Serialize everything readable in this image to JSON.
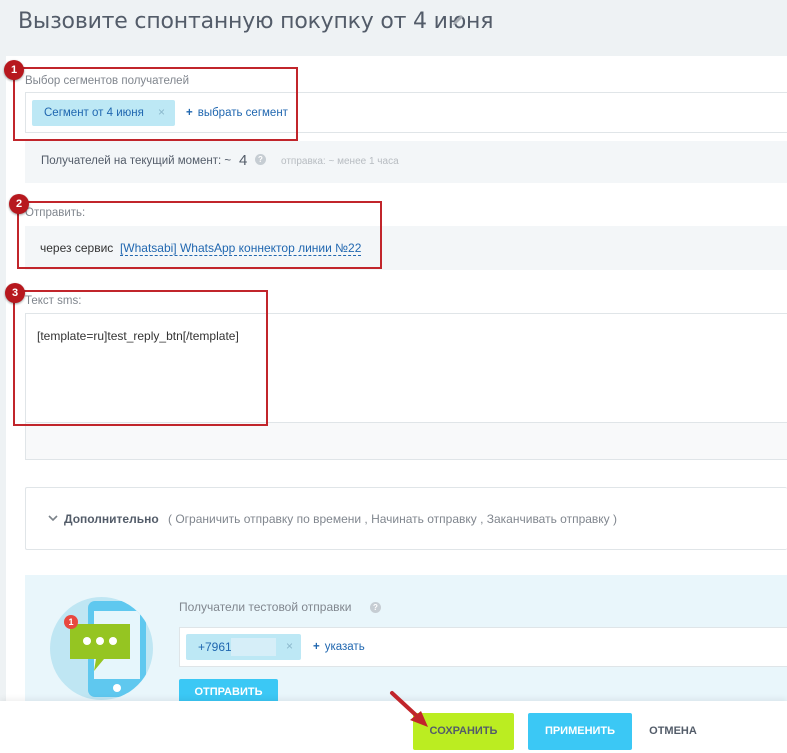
{
  "page": {
    "title": "Вызовите спонтанную покупку от 4 июня"
  },
  "recipients": {
    "section_label": "Выбор сегментов получателей",
    "selected_segment": "Сегмент от 4 июня",
    "chip_remove": "×",
    "add_segment_label": "выбрать сегмент",
    "add_plus": "+",
    "count_label": "Получателей на текущий момент: ~",
    "count_value": "4",
    "help": "?",
    "send_time_hint": "отправка: ~ менее 1 часа"
  },
  "send": {
    "section_label": "Отправить:",
    "via_label": "через сервис",
    "service_link": "[Whatsabi] WhatsApp коннектор линии №22"
  },
  "sms": {
    "section_label": "Текст sms:",
    "text": "[template=ru]test_reply_btn[/template]"
  },
  "additional": {
    "title": "Дополнительно",
    "options_text": "( Ограничить отправку по времени ,   Начинать отправку ,   Заканчивать отправку   )"
  },
  "test": {
    "label": "Получатели тестовой отправки",
    "help": "?",
    "phone": "+7961",
    "chip_remove": "×",
    "add_label": "указать",
    "add_plus": "+",
    "send_button": "ОТПРАВИТЬ",
    "notification_count": "1"
  },
  "actions": {
    "save": "СОХРАНИТЬ",
    "apply": "ПРИМЕНИТЬ",
    "cancel": "ОТМЕНА"
  },
  "annotations": [
    "1",
    "2",
    "3"
  ],
  "colors": {
    "accent_blue": "#2067b0",
    "chip_bg": "#bde8f5",
    "save_green": "#bbed21",
    "apply_blue": "#3bc8f5",
    "annotation_red": "#c1252b"
  }
}
